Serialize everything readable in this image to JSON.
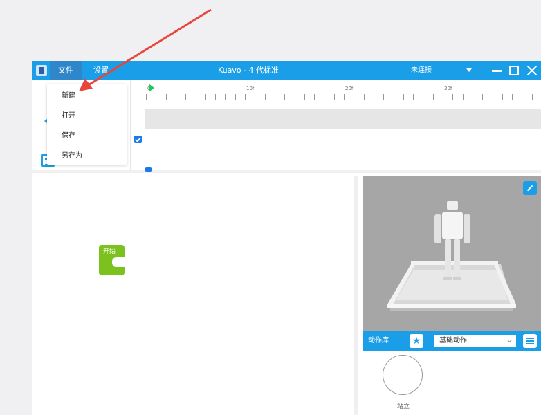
{
  "titlebar": {
    "menu_file": "文件",
    "menu_settings": "设置",
    "title": "Kuavo - 4 代标准",
    "connection_status": "未连接"
  },
  "file_menu": {
    "items": [
      {
        "label": "新建"
      },
      {
        "label": "打开"
      },
      {
        "label": "保存"
      },
      {
        "label": "另存为"
      }
    ]
  },
  "timeline": {
    "tick_labels": [
      "0f",
      "10f",
      "20f",
      "30f"
    ]
  },
  "workspace": {
    "start_block_label": "开始"
  },
  "action_library": {
    "label": "动作库",
    "category_selected": "基础动作",
    "actions": [
      {
        "label": "站立"
      }
    ]
  },
  "colors": {
    "accent": "#1a9ee8",
    "start_block": "#7cc21e",
    "playhead": "#22c55e",
    "annotation": "#e8453c"
  }
}
